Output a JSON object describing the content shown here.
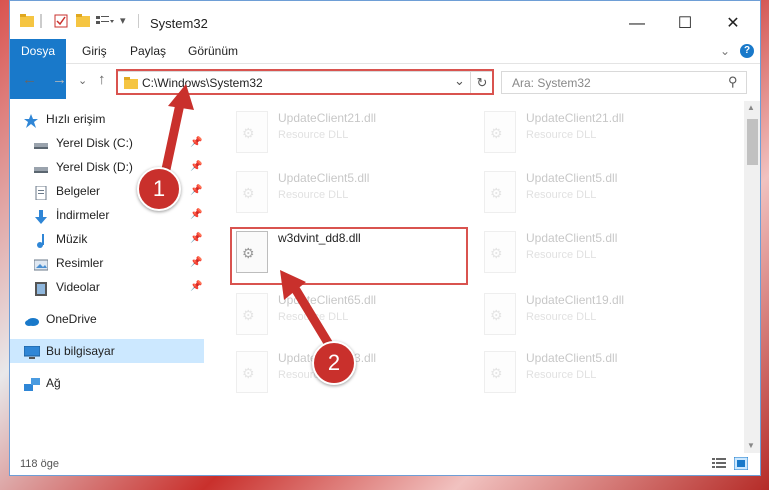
{
  "window": {
    "title": "System32",
    "controls": {
      "minimize": "—",
      "maximize": "☐",
      "close": "✕"
    }
  },
  "ribbon": {
    "tabs": [
      {
        "label": "Dosya"
      },
      {
        "label": "Giriş"
      },
      {
        "label": "Paylaş"
      },
      {
        "label": "Görünüm"
      }
    ],
    "expand_glyph": "⌄",
    "help_glyph": "?"
  },
  "nav": {
    "back": "←",
    "forward": "→",
    "recent": "⌄",
    "up": "↑"
  },
  "address": {
    "path": "C:\\Windows\\System32",
    "dropdown": "⌄",
    "refresh": "↻"
  },
  "search": {
    "placeholder": "Ara: System32",
    "icon": "⚲"
  },
  "sidebar": {
    "quick_access": "Hızlı erişim",
    "items": [
      {
        "label": "Yerel Disk (C:)",
        "icon": "drive-icon"
      },
      {
        "label": "Yerel Disk (D:)",
        "icon": "drive-icon"
      },
      {
        "label": "Belgeler",
        "icon": "documents-icon"
      },
      {
        "label": "İndirmeler",
        "icon": "downloads-icon"
      },
      {
        "label": "Müzik",
        "icon": "music-icon"
      },
      {
        "label": "Resimler",
        "icon": "pictures-icon"
      },
      {
        "label": "Videolar",
        "icon": "videos-icon"
      }
    ],
    "onedrive": "OneDrive",
    "this_pc": "Bu bilgisayar",
    "network": "Ağ",
    "pin_glyph": "📌"
  },
  "files": [
    {
      "name": "UpdateClient21.dll",
      "type": "Resource DLL"
    },
    {
      "name": "UpdateClient21.dll",
      "type": "Resource DLL"
    },
    {
      "name": "UpdateClient5.dll",
      "type": "Resource DLL"
    },
    {
      "name": "UpdateClient5.dll",
      "type": "Resource DLL"
    },
    {
      "name": "w3dvint_dd8.dll",
      "type": ""
    },
    {
      "name": "UpdateClient5.dll",
      "type": "Resource DLL"
    },
    {
      "name": "UpdateClient65.dll",
      "type": "Resource DLL"
    },
    {
      "name": "UpdateClient19.dll",
      "type": "Resource DLL"
    },
    {
      "name": "UpdateClient63.dll",
      "type": "Resource DLL"
    },
    {
      "name": "UpdateClient5.dll",
      "type": "Resource DLL"
    }
  ],
  "status": {
    "count": "118 öge"
  },
  "badges": {
    "one": "1",
    "two": "2"
  },
  "colors": {
    "accent": "#1979ca",
    "highlight": "#d9534f",
    "selected": "#cce8ff"
  }
}
